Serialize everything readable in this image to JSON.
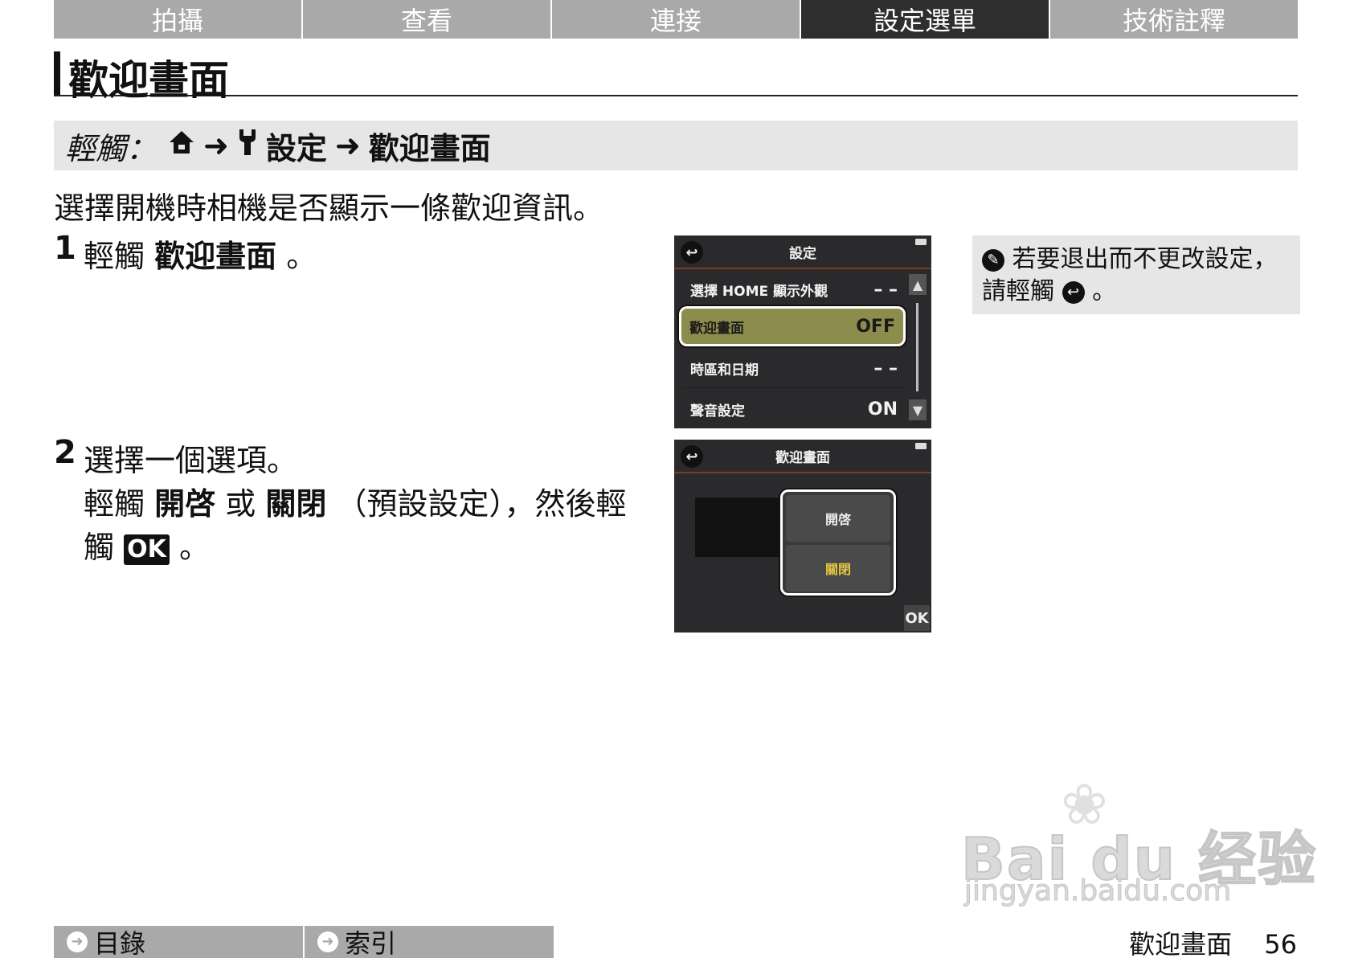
{
  "tabs": [
    {
      "label": "拍攝",
      "active": false
    },
    {
      "label": "查看",
      "active": false
    },
    {
      "label": "連接",
      "active": false
    },
    {
      "label": "設定選單",
      "active": true
    },
    {
      "label": "技術註釋",
      "active": false
    }
  ],
  "title": "歡迎畫面",
  "path": {
    "prefix": "輕觸：",
    "home_icon": "home-icon",
    "arrow1": "➜",
    "wrench_icon": "wrench-icon",
    "setting": "設定",
    "arrow2": "➜",
    "target": "歡迎畫面"
  },
  "intro": "選擇開機時相機是否顯示一條歡迎資訊。",
  "step1": {
    "num": "1",
    "pre": "輕觸",
    "bold": "歡迎畫面",
    "post": "。"
  },
  "step2": {
    "num": "2",
    "line1": "選擇一個選項。",
    "line2_pre": "輕觸",
    "line2_b1": "開啓",
    "line2_mid": "或",
    "line2_b2": "關閉",
    "line2_post": "（預設設定），然後輕",
    "line3_pre": "觸",
    "ok": "OK",
    "line3_post": "。"
  },
  "screen1": {
    "header": "設定",
    "back": "↩",
    "rows": [
      {
        "label": "選擇 HOME 顯示外觀",
        "value": "– –"
      },
      {
        "label": "歡迎畫面",
        "value": "OFF"
      },
      {
        "label": "時區和日期",
        "value": "– –"
      },
      {
        "label": "聲音設定",
        "value": "ON"
      }
    ],
    "up": "▲",
    "down": "▼"
  },
  "screen2": {
    "header": "歡迎畫面",
    "back": "↩",
    "options": [
      "開啓",
      "關閉"
    ],
    "ok": "OK"
  },
  "note": {
    "icon": "pencil-icon",
    "line1": "若要退出而不更改設定，",
    "line2_pre": "請輕觸",
    "back_icon": "↩",
    "line2_post": "。"
  },
  "watermark": {
    "main": "Bai du 经验",
    "sub": "jingyan.baidu.com"
  },
  "footer": {
    "toc": "目錄",
    "index": "索引",
    "page_title": "歡迎畫面",
    "page_number": "56"
  }
}
